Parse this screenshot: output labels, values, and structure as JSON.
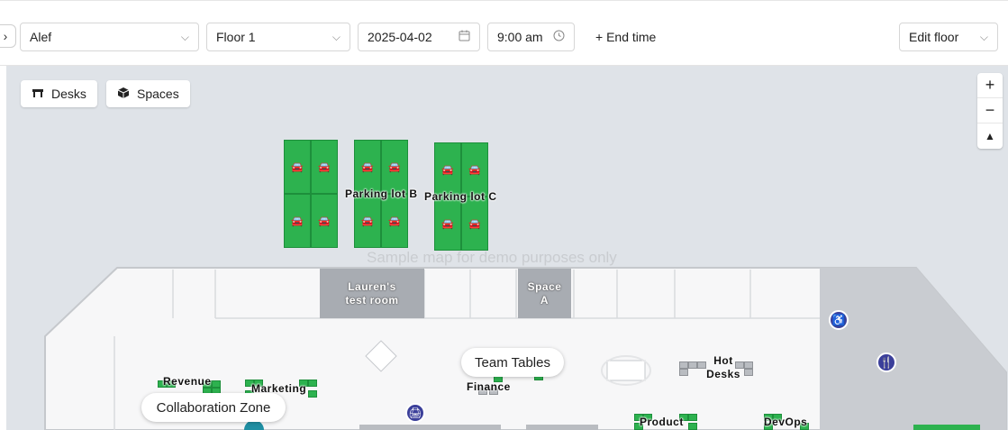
{
  "toolbar": {
    "location": "Alef",
    "floor": "Floor 1",
    "date": "2025-04-02",
    "time": "9:00 am",
    "end_time_label": "+ End time",
    "edit_floor_label": "Edit floor"
  },
  "map": {
    "chips": {
      "desks": "Desks",
      "spaces": "Spaces"
    },
    "zoom": {
      "in": "+",
      "out": "−",
      "reset": "▲"
    },
    "watermark": "Sample map for demo purposes only",
    "parking": [
      {
        "label": "Parking lot B"
      },
      {
        "label": "Parking lot C"
      }
    ],
    "rooms": [
      {
        "label": "Lauren's test room"
      },
      {
        "label": "Space A"
      }
    ],
    "pills": {
      "team_tables": "Team Tables",
      "collaboration_zone": "Collaboration Zone"
    },
    "areas": {
      "revenue": "Revenue",
      "marketing": "Marketing",
      "finance": "Finance",
      "hot_desks": "Hot Desks",
      "product": "Product",
      "devops": "DevOps"
    },
    "icons": {
      "accessible": "accessible-icon",
      "restaurant": "restaurant-icon",
      "parking_spot": "car-icon",
      "printer": "printer-icon"
    }
  }
}
